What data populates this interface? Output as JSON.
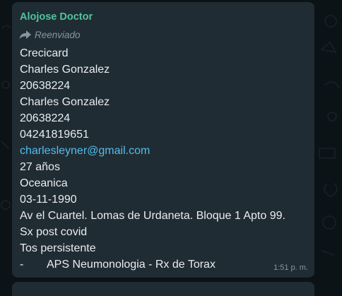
{
  "colors": {
    "bubble": "#202c33",
    "sender_name": "#4fc3a1",
    "text": "#e9edef",
    "muted": "#8696a0",
    "link": "#53bdeb",
    "background": "#0c1317"
  },
  "message": {
    "sender": "Alojose Doctor",
    "forwarded_label": "Reenviado",
    "forwarded_icon": "forward-arrow-icon",
    "lines": {
      "l1": "Crecicard",
      "l2": "Charles Gonzalez",
      "l3": "20638224",
      "l4": "Charles Gonzalez",
      "l5": "20638224",
      "l6": "04241819651",
      "email": "charlesleyner@gmail.com",
      "l8": "27 años",
      "l9": "Oceanica",
      "l10": "03-11-1990",
      "l11": "Av el Cuartel. Lomas de Urdaneta. Bloque 1 Apto 99.",
      "l12": "Sx post covid",
      "l13": "Tos persistente",
      "l14_dash": "-",
      "l14_text": "APS Neumonologia - Rx de Torax"
    },
    "time": "1:51 p. m."
  }
}
